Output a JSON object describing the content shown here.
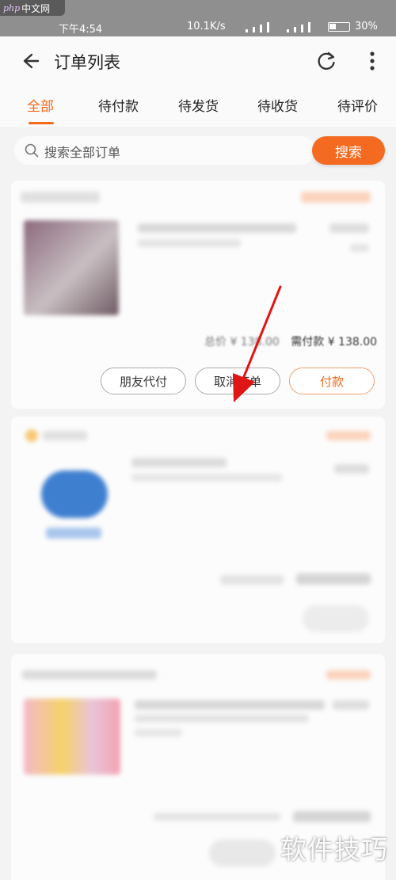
{
  "status_bar": {
    "logo_php": "php",
    "logo_cn": "中文网",
    "time": "下午4:54",
    "network_speed": "10.1K/s",
    "battery": "30%"
  },
  "header": {
    "title": "订单列表"
  },
  "tabs": [
    {
      "label": "全部",
      "active": true
    },
    {
      "label": "待付款"
    },
    {
      "label": "待发货"
    },
    {
      "label": "待收货"
    },
    {
      "label": "待评价"
    }
  ],
  "search": {
    "placeholder": "搜索全部订单",
    "button_label": "搜索"
  },
  "order1": {
    "total_label": "总价 ¥ 138.00",
    "need_pay_label": "需付款 ¥ 138.00",
    "buttons": {
      "friend_pay": "朋友代付",
      "cancel_order": "取消订单",
      "pay": "付款"
    }
  },
  "watermark": "软件技巧",
  "colors": {
    "accent": "#f36c1d",
    "arrow": "#e01515"
  }
}
